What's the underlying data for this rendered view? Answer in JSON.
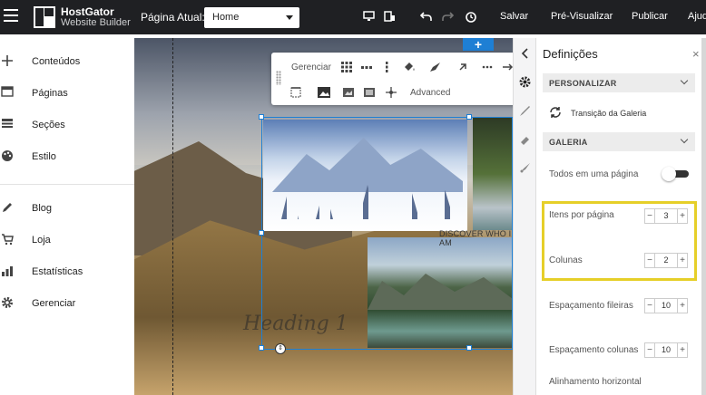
{
  "topbar": {
    "logo_line1": "HostGator",
    "logo_line2": "Website Builder",
    "page_label": "Página Atual:",
    "page_select_value": "Home",
    "icons": [
      "desktop-icon",
      "mobile-icon",
      "undo-icon",
      "redo-icon",
      "history-icon"
    ],
    "save": "Salvar",
    "preview": "Pré-Visualizar",
    "publish": "Publicar",
    "help": "Ajud"
  },
  "sidebar": {
    "items": [
      {
        "label": "Conteúdos",
        "icon": "plus-icon"
      },
      {
        "label": "Páginas",
        "icon": "pages-icon"
      },
      {
        "label": "Seções",
        "icon": "sections-icon"
      },
      {
        "label": "Estilo",
        "icon": "palette-icon"
      },
      {
        "label": "Blog",
        "icon": "pencil-icon"
      },
      {
        "label": "Loja",
        "icon": "cart-icon"
      },
      {
        "label": "Estatísticas",
        "icon": "chart-icon"
      },
      {
        "label": "Gerenciar",
        "icon": "gear-icon"
      }
    ]
  },
  "toolbar": {
    "manage": "Gerenciar",
    "advanced": "Advanced"
  },
  "canvas": {
    "discover_text": "DISCOVER WHO I AM",
    "heading_text": "Heading 1",
    "add_symbol": "+"
  },
  "panel": {
    "title": "Definições",
    "close": "×",
    "section_personalize": "PERSONALIZAR",
    "gallery_transition": "Transição da Galeria",
    "section_gallery": "GALERIA",
    "all_on_one_page": "Todos em uma página",
    "all_on_one_page_on": false,
    "items_per_page_label": "Itens por página",
    "items_per_page": "3",
    "columns_label": "Colunas",
    "columns": "2",
    "row_spacing_label": "Espaçamento fileiras",
    "row_spacing": "10",
    "column_spacing_label": "Espaçamento colunas",
    "column_spacing": "10",
    "horizontal_align_label": "Alinhamento horizontal"
  },
  "colors": {
    "topbar_bg": "#1f2023",
    "accent": "#1e7fd4",
    "highlight": "#e6cf29"
  }
}
